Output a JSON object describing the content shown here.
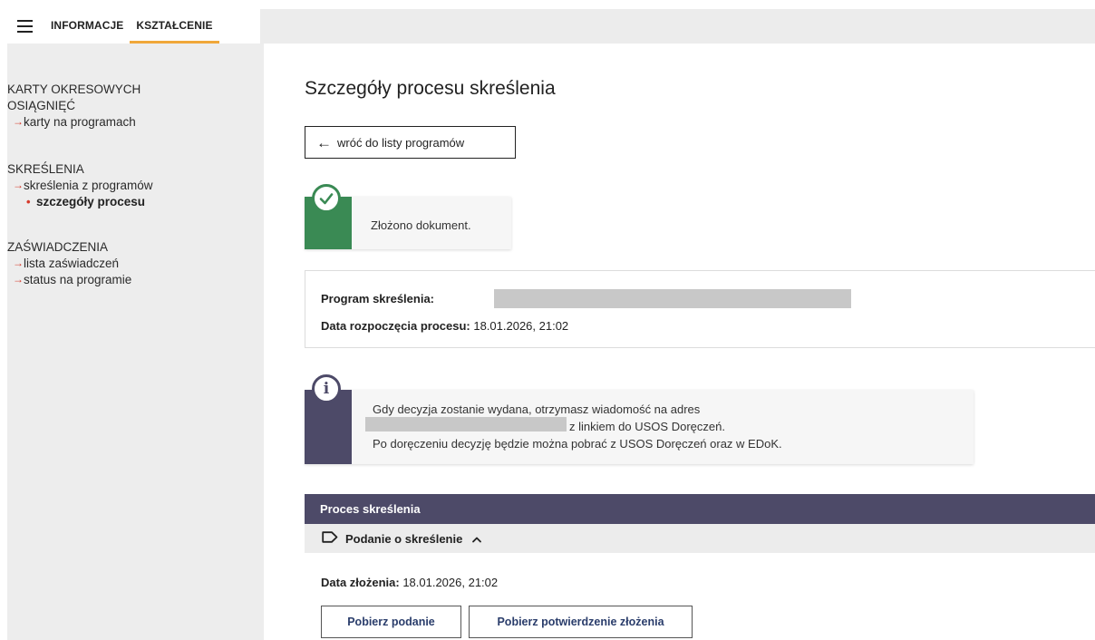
{
  "topnav": {
    "tabs": [
      {
        "label": "INFORMACJE",
        "active": false
      },
      {
        "label": "KSZTAŁCENIE",
        "active": true
      }
    ]
  },
  "sidebar": {
    "sections": [
      {
        "heading_line1": "KARTY OKRESOWYCH",
        "heading_line2": "OSIĄGNIĘĆ",
        "links": [
          "karty na programach"
        ]
      },
      {
        "heading": "SKREŚLENIA",
        "links": [
          "skreślenia z programów"
        ],
        "current": "szczegóły procesu"
      },
      {
        "heading": "ZAŚWIADCZENIA",
        "links": [
          "lista zaświadczeń",
          "status na programie"
        ]
      }
    ]
  },
  "main": {
    "title": "Szczegóły procesu skreślenia",
    "back_button": "wróć do listy programów",
    "success_message": "Złożono dokument.",
    "details": {
      "program_label": "Program skreślenia:",
      "start_label": "Data rozpoczęcia procesu:",
      "start_value": "18.01.2026, 21:02"
    },
    "notice": {
      "line1": "Gdy decyzja zostanie wydana, otrzymasz wiadomość na adres",
      "line2_suffix": "z linkiem do USOS Doręczeń.",
      "line3": "Po doręczeniu decyzję będzie można pobrać z USOS Doręczeń oraz w EDoK."
    },
    "process": {
      "header": "Proces skreślenia",
      "step_title": "Podanie o skreślenie",
      "submitted_label": "Data złożenia:",
      "submitted_value": "18.01.2026, 21:02",
      "buttons": {
        "download_application": "Pobierz podanie",
        "download_confirmation": "Pobierz potwierdzenie złożenia"
      }
    }
  },
  "colors": {
    "accent_tab": "#f0a73a",
    "success": "#3a8a54",
    "notice": "#4d4a68",
    "sidebar_arrow": "#d63a2b",
    "button_text": "#2a3d6b"
  },
  "icons": [
    "hamburger-menu-icon",
    "arrow-left-icon",
    "check-circle-icon",
    "info-circle-icon",
    "tag-icon",
    "chevron-up-icon",
    "arrow-right-icon",
    "bullet-dot-icon"
  ]
}
